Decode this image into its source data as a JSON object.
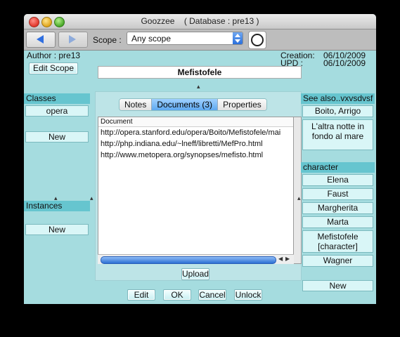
{
  "window": {
    "app_name": "Goozzee",
    "database_label": "( Database : pre13 )"
  },
  "toolbar": {
    "back_icon": "back-arrow-icon",
    "forward_icon": "forward-arrow-icon",
    "scope_label": "Scope :",
    "scope_value": "Any scope",
    "record_icon": "circle-icon"
  },
  "header": {
    "author": "Author : pre13",
    "edit_scope": "Edit Scope",
    "creation_label": "Creation:",
    "creation_date": "06/10/2009",
    "upd_label": "UPD :",
    "upd_date": "06/10/2009",
    "item_name": "Mefistofele"
  },
  "left": {
    "classes_header": "Classes",
    "classes": [
      "opera"
    ],
    "classes_new": "New",
    "instances_header": "Instances",
    "instances_new": "New"
  },
  "center": {
    "tabs": [
      {
        "label": "Notes",
        "active": false
      },
      {
        "label": "Documents (3)",
        "active": true
      },
      {
        "label": "Properties",
        "active": false
      }
    ],
    "column_header": "Document",
    "documents": [
      "http://opera.stanford.edu/opera/Boito/Mefistofele/mai",
      "http://php.indiana.edu/~lneff/libretti/MefPro.html",
      "http://www.metopera.org/synopses/mefisto.html"
    ],
    "upload": "Upload",
    "actions": [
      "Edit",
      "OK",
      "Cancel",
      "Unlock"
    ]
  },
  "right": {
    "see_also_header": "See also..vxvsdvsf",
    "see_also": [
      "Boito, Arrigo",
      "L'altra notte in fondo al mare"
    ],
    "character_header": "character",
    "characters": [
      "Elena",
      "Faust",
      "Margherita",
      "Marta",
      "Mefistofele [character]",
      "Wagner"
    ],
    "new": "New"
  },
  "colors": {
    "window_bg": "#a5dcdf",
    "pane_header": "#66c5cf",
    "chip_bg": "#d9f6f7",
    "selected_tab": "#5ea8f0"
  }
}
